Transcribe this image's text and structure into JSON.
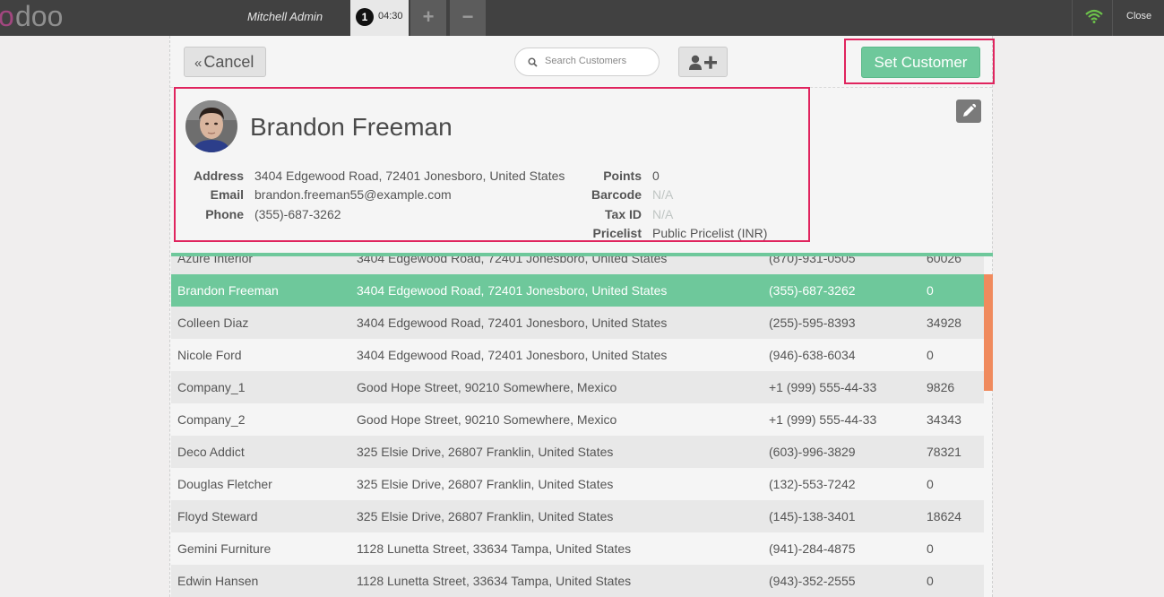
{
  "topbar": {
    "cashier": "Mitchell Admin",
    "order_number": "1",
    "order_time": "04:30",
    "add_tab": "+",
    "remove_tab": "−",
    "close": "Close",
    "logo_text": "odoo",
    "colors": {
      "bar": "#414141",
      "wifi": "#6cc24a",
      "logo_o": "#a2477f",
      "logo_doo": "#8f8f8f"
    }
  },
  "screen": {
    "cancel_chevron": "«",
    "cancel_label": "Cancel",
    "search_placeholder": "Search Customers",
    "add_customer_icon": "user-plus-icon",
    "set_customer_label": "Set Customer",
    "colors": {
      "accent": "#6ec89b",
      "highlight_border": "#e0245e",
      "scrollbar": "#f08a5d"
    }
  },
  "customer": {
    "name": "Brandon Freeman",
    "left_fields": [
      {
        "label": "Address",
        "value": "3404 Edgewood Road, 72401 Jonesboro, United States"
      },
      {
        "label": "Email",
        "value": "brandon.freeman55@example.com"
      },
      {
        "label": "Phone",
        "value": "(355)-687-3262"
      }
    ],
    "right_fields": [
      {
        "label": "Points",
        "value": "0"
      },
      {
        "label": "Barcode",
        "value": "N/A"
      },
      {
        "label": "Tax ID",
        "value": "N/A"
      },
      {
        "label": "Pricelist",
        "value": "Public Pricelist (INR)"
      }
    ]
  },
  "customers": [
    {
      "name": "Azure Interior",
      "address": "3404 Edgewood Road, 72401 Jonesboro, United States",
      "phone": "(870)-931-0505",
      "points": "60026"
    },
    {
      "name": "Brandon Freeman",
      "address": "3404 Edgewood Road, 72401 Jonesboro, United States",
      "phone": "(355)-687-3262",
      "points": "0",
      "selected": true
    },
    {
      "name": "Colleen Diaz",
      "address": "3404 Edgewood Road, 72401 Jonesboro, United States",
      "phone": "(255)-595-8393",
      "points": "34928"
    },
    {
      "name": "Nicole Ford",
      "address": "3404 Edgewood Road, 72401 Jonesboro, United States",
      "phone": "(946)-638-6034",
      "points": "0"
    },
    {
      "name": "Company_1",
      "address": "Good Hope Street, 90210 Somewhere, Mexico",
      "phone": "+1 (999) 555-44-33",
      "points": "9826"
    },
    {
      "name": "Company_2",
      "address": "Good Hope Street, 90210 Somewhere, Mexico",
      "phone": "+1 (999) 555-44-33",
      "points": "34343"
    },
    {
      "name": "Deco Addict",
      "address": "325 Elsie Drive, 26807 Franklin, United States",
      "phone": "(603)-996-3829",
      "points": "78321"
    },
    {
      "name": "Douglas Fletcher",
      "address": "325 Elsie Drive, 26807 Franklin, United States",
      "phone": "(132)-553-7242",
      "points": "0"
    },
    {
      "name": "Floyd Steward",
      "address": "325 Elsie Drive, 26807 Franklin, United States",
      "phone": "(145)-138-3401",
      "points": "18624"
    },
    {
      "name": "Gemini Furniture",
      "address": "1128 Lunetta Street, 33634 Tampa, United States",
      "phone": "(941)-284-4875",
      "points": "0"
    },
    {
      "name": "Edwin Hansen",
      "address": "1128 Lunetta Street, 33634 Tampa, United States",
      "phone": "(943)-352-2555",
      "points": "0"
    }
  ]
}
